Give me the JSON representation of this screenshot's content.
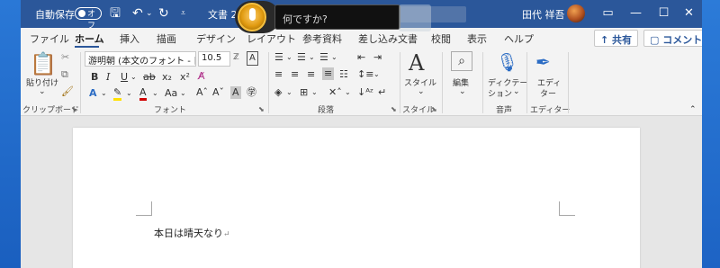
{
  "titlebar": {
    "autosave_label": "自動保存",
    "autosave_state": "オフ",
    "doc_title": "文書 2",
    "user_name": "田代 祥吾",
    "bg_color": "#2b579a"
  },
  "help_popup": {
    "placeholder": "何ですか?"
  },
  "tabs": [
    "ファイル",
    "ホーム",
    "挿入",
    "描画",
    "デザイン",
    "レイアウト",
    "参考資料",
    "差し込み文書",
    "校閲",
    "表示",
    "ヘルプ"
  ],
  "active_tab": "ホーム",
  "share_label": "共有",
  "comment_label": "コメント",
  "ribbon": {
    "clipboard": {
      "paste_label": "貼り付け",
      "group_label": "クリップボード"
    },
    "font": {
      "font_name": "游明朝 (本文のフォント - 日本",
      "font_size": "10.5",
      "group_label": "フォント"
    },
    "paragraph": {
      "group_label": "段落"
    },
    "styles": {
      "button_label": "スタイル",
      "group_label": "スタイル"
    },
    "editing": {
      "button_label": "編集"
    },
    "voice": {
      "dictation_label_1": "ディクテー",
      "dictation_label_2": "ション",
      "group_label": "音声"
    },
    "editor": {
      "button_label_1": "エディ",
      "button_label_2": "ター",
      "group_label": "エディター"
    }
  },
  "document": {
    "text": "本日は晴天なり"
  }
}
